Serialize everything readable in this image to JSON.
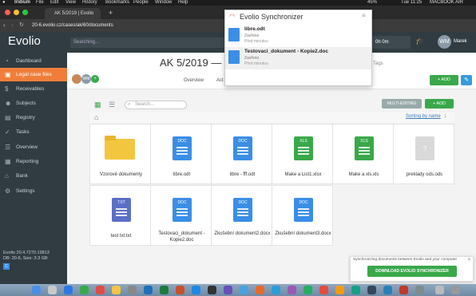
{
  "menubar": {
    "app": "Iridium",
    "items": [
      "File",
      "Edit",
      "View",
      "History",
      "Bookmarks",
      "People",
      "Window",
      "Help"
    ],
    "battery": "45%",
    "clock": "Tue 11:25",
    "machine": "MACBOOK AIR"
  },
  "browser": {
    "tab_title": "AK 5/2019 | Evolio",
    "url": "20-6.evolio.cz/cases/ak/60/documents"
  },
  "topbar": {
    "logo": "Evolio",
    "search_placeholder": "Searching...",
    "timer": "0h 0m",
    "avatar_initials": "WM",
    "user": "Marek"
  },
  "sidebar": {
    "items": [
      {
        "label": "Dashboard",
        "icon": "speedometer-icon"
      },
      {
        "label": "Legal case files",
        "icon": "briefcase-icon",
        "active": true
      },
      {
        "label": "Receivables",
        "icon": "dollar-icon"
      },
      {
        "label": "Subjects",
        "icon": "person-icon"
      },
      {
        "label": "Registry",
        "icon": "file-icon"
      },
      {
        "label": "Tasks",
        "icon": "check-icon"
      },
      {
        "label": "Overview",
        "icon": "list-icon"
      },
      {
        "label": "Reporting",
        "icon": "chart-icon"
      },
      {
        "label": "Bank",
        "icon": "bank-icon"
      },
      {
        "label": "Settings",
        "icon": "gear-icon"
      }
    ],
    "version_line1": "Evolio 20.4.7270.19813",
    "version_line2": "DB: 20-6, Size: 3.3 GB",
    "badge": "C"
  },
  "header": {
    "title": "AK 5/2019 — ",
    "avatar_initials": "WM",
    "tabs": [
      "Overview",
      "Act"
    ],
    "tags": "Tags",
    "add_label": "+ ADD",
    "edit_icon": "pencil-icon"
  },
  "toolbar": {
    "search_placeholder": "Search...",
    "multi_label": "MULTI-EDITING",
    "add_label": "+ ADD",
    "sort_label": "Sorting by name"
  },
  "files": [
    {
      "name": "Vzorové dokumenty",
      "type": "folder"
    },
    {
      "name": "libre.odt",
      "type": "DOC",
      "color": "#3a8ee6"
    },
    {
      "name": "libre - fff.odt",
      "type": "DOC",
      "color": "#3a8ee6"
    },
    {
      "name": "Make a List1.xlsx",
      "type": "XLS",
      "color": "#3aa84a"
    },
    {
      "name": "Make a xls.xls",
      "type": "XLS",
      "color": "#3aa84a"
    },
    {
      "name": "preklady ods.ods",
      "type": "?",
      "color": "#d9d9d9"
    },
    {
      "name": "test txt.txt",
      "type": "TXT",
      "color": "#5b6fc7"
    },
    {
      "name": "Testovaci_dokument - Kopie2.doc",
      "type": "DOC",
      "color": "#3a8ee6"
    },
    {
      "name": "Zkušební dokument2.docx",
      "type": "DOC",
      "color": "#3a8ee6"
    },
    {
      "name": "Zkušební dokument3.docx",
      "type": "DOC",
      "color": "#3a8ee6"
    }
  ],
  "sync": {
    "title": "Evolio Synchronizer",
    "rows": [
      {
        "name": "libre.odt",
        "status": "Zavřeno",
        "time": "Před minutou"
      },
      {
        "name": "Testovaci_dokument - Kopie2.doc",
        "status": "Zavřeno",
        "time": "Před minutou"
      }
    ]
  },
  "banner": {
    "text": "Synchronizing documents between Evolio and your computer",
    "button": "DOWNLOAD EVOLIO SYNCHRONIZER"
  },
  "colors": {
    "accent": "#f07e3a",
    "green": "#3aa84a",
    "sidebar": "#303c42",
    "doc_blue": "#3a8ee6"
  }
}
